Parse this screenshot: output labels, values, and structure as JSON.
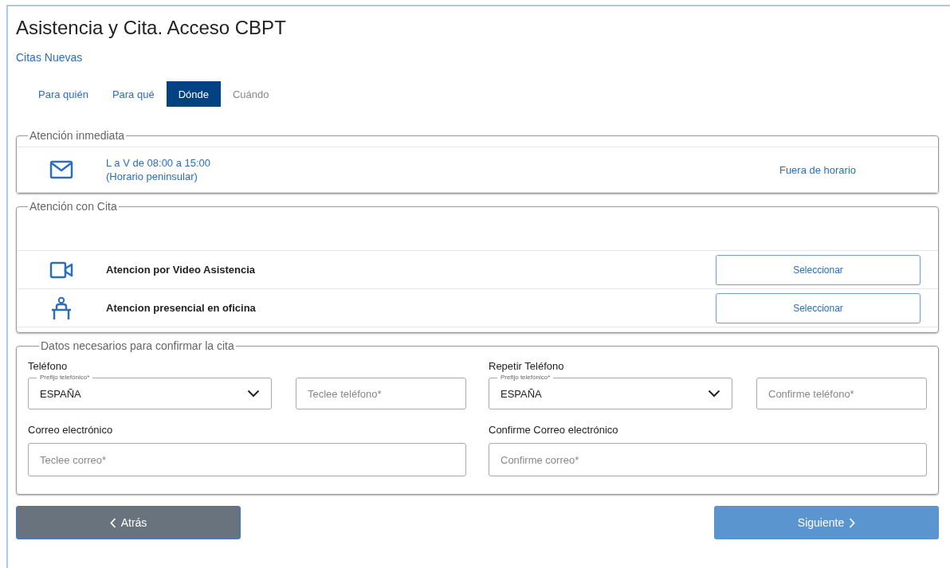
{
  "title": "Asistencia y Cita. Acceso CBPT",
  "subtitle": "Citas Nuevas",
  "tabs": [
    {
      "label": "Para quién",
      "selected": false,
      "disabled": false
    },
    {
      "label": "Para qué",
      "selected": false,
      "disabled": false
    },
    {
      "label": "Dónde",
      "selected": true,
      "disabled": false
    },
    {
      "label": "Cuándo",
      "selected": false,
      "disabled": true
    }
  ],
  "immediate": {
    "legend": "Atención inmediata",
    "kind": "mail",
    "hours": "L a V de 08:00 a 15:00",
    "note": "(Horario peninsular)",
    "status": "Fuera de horario"
  },
  "appointment": {
    "legend": "Atención con Cita",
    "options": [
      {
        "kind": "video",
        "label": "Atencion por Video Asistencia",
        "button": "Seleccionar"
      },
      {
        "kind": "office",
        "label": "Atencion presencial en oficina",
        "button": "Seleccionar"
      }
    ]
  },
  "details": {
    "legend": "Datos necesarios para confirmar la cita",
    "groups": [
      {
        "label": "Teléfono",
        "prefix_label": "Prefijo telefónico*",
        "prefix_value": "ESPAÑA",
        "phone_placeholder": "Teclee teléfono*",
        "email_label": "Correo electrónico",
        "email_placeholder": "Teclee correo*"
      },
      {
        "label": "Repetir Teléfono",
        "prefix_label": "Prefijo telefónico*",
        "prefix_value": "ESPAÑA",
        "phone_placeholder": "Confirme teléfono*",
        "email_label": "Confirme Correo electrónico",
        "email_placeholder": "Confirme correo*"
      }
    ]
  },
  "buttons": [
    {
      "kind": "back",
      "label": "Atrás"
    },
    {
      "kind": "next",
      "label": "Siguiente"
    }
  ]
}
